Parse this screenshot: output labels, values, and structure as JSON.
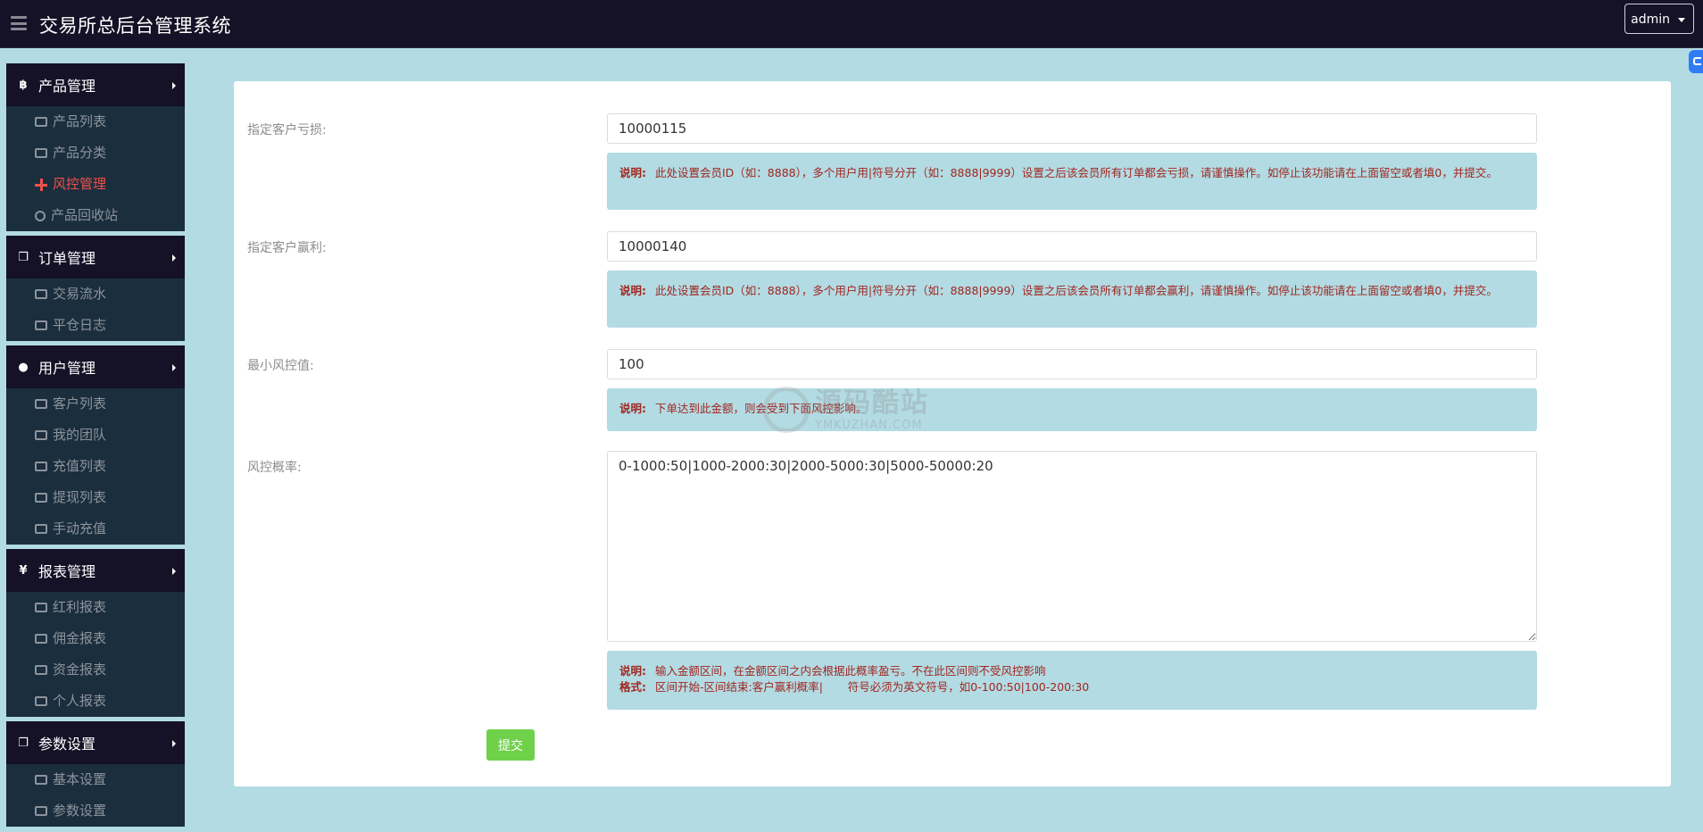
{
  "header": {
    "title": "交易所总后台管理系统",
    "user": "admin"
  },
  "sidebar": {
    "groups": [
      {
        "label": "产品管理",
        "icon": "bitcoin-icon",
        "items": [
          {
            "label": "产品列表",
            "icon": "list-icon"
          },
          {
            "label": "产品分类",
            "icon": "outdent-icon"
          },
          {
            "label": "风控管理",
            "icon": "arrows-icon",
            "active": true
          },
          {
            "label": "产品回收站",
            "icon": "close-circle-icon"
          }
        ]
      },
      {
        "label": "订单管理",
        "icon": "copy-icon",
        "items": [
          {
            "label": "交易流水",
            "icon": "align-icon"
          },
          {
            "label": "平仓日志",
            "icon": "outdent-icon"
          }
        ]
      },
      {
        "label": "用户管理",
        "icon": "user-icon",
        "items": [
          {
            "label": "客户列表",
            "icon": "user-icon"
          },
          {
            "label": "我的团队",
            "icon": "team-icon"
          },
          {
            "label": "充值列表",
            "icon": "money-icon"
          },
          {
            "label": "提现列表",
            "icon": "money-icon"
          },
          {
            "label": "手动充值",
            "icon": "money-icon"
          }
        ]
      },
      {
        "label": "报表管理",
        "icon": "yen-icon",
        "items": [
          {
            "label": "红利报表",
            "icon": "money-icon"
          },
          {
            "label": "佣金报表",
            "icon": "money-icon"
          },
          {
            "label": "资金报表",
            "icon": "money-icon"
          },
          {
            "label": "个人报表",
            "icon": "money-icon"
          }
        ]
      },
      {
        "label": "参数设置",
        "icon": "copy-icon",
        "items": [
          {
            "label": "基本设置",
            "icon": "money-icon"
          },
          {
            "label": "参数设置",
            "icon": "money-icon"
          }
        ]
      }
    ]
  },
  "form": {
    "loss": {
      "label": "指定客户亏损:",
      "value": "10000115",
      "note_prefix": "说明:",
      "note": "此处设置会员ID（如：8888），多个用户用|符号分开（如：8888|9999）设置之后该会员所有订单都会亏损，请谨慎操作。如停止该功能请在上面留空或者填0，并提交。"
    },
    "win": {
      "label": "指定客户赢利:",
      "value": "10000140",
      "note_prefix": "说明:",
      "note": "此处设置会员ID（如：8888），多个用户用|符号分开（如：8888|9999）设置之后该会员所有订单都会赢利，请谨慎操作。如停止该功能请在上面留空或者填0，并提交。"
    },
    "min_risk": {
      "label": "最小风控值:",
      "value": "100",
      "note_prefix": "说明:",
      "note": "下单达到此金额，则会受到下面风控影响。"
    },
    "risk_rate": {
      "label": "风控概率:",
      "value": "0-1000:50|1000-2000:30|2000-5000:30|5000-50000:20",
      "note_prefix": "说明:",
      "note": "输入金额区间，在金额区间之内会根据此概率盈亏。不在此区间则不受风控影响",
      "format_prefix": "格式:",
      "format": "区间开始-区间结束:客户赢利概率|       符号必须为英文符号，如0-100:50|100-200:30"
    },
    "submit_label": "提交"
  },
  "watermark": {
    "cn": "源码酷站",
    "en": "YMKUZHAN.COM"
  },
  "colors": {
    "topbar": "#151126",
    "background": "#b3dbe3",
    "active": "#f0504a",
    "note_text": "#a1261f",
    "submit": "#6fd14a"
  }
}
